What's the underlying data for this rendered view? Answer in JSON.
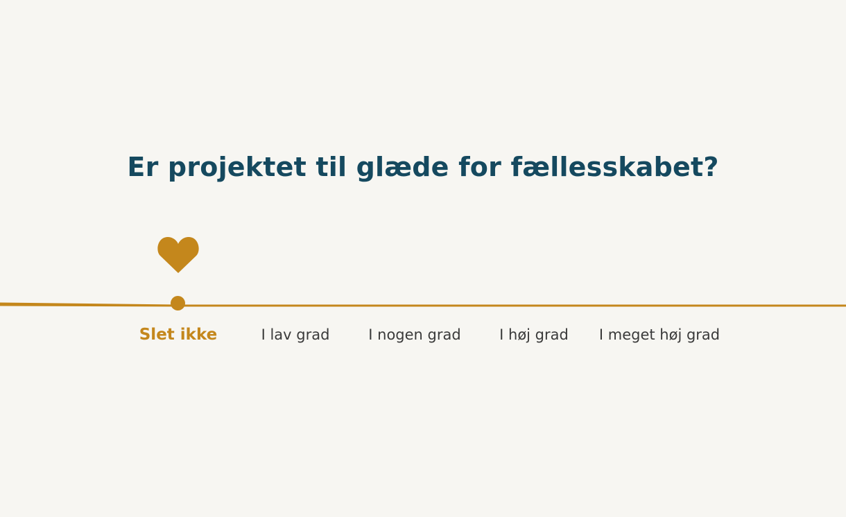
{
  "question": "Er projektet til glæde for fællesskabet?",
  "scale": {
    "selected_index": 0,
    "accent_color": "#c4871c",
    "title_color": "#15495f",
    "marker_icon": "heart-icon",
    "options": [
      "Slet ikke",
      "I lav grad",
      "I nogen grad",
      "I høj grad",
      "I meget høj grad"
    ]
  }
}
